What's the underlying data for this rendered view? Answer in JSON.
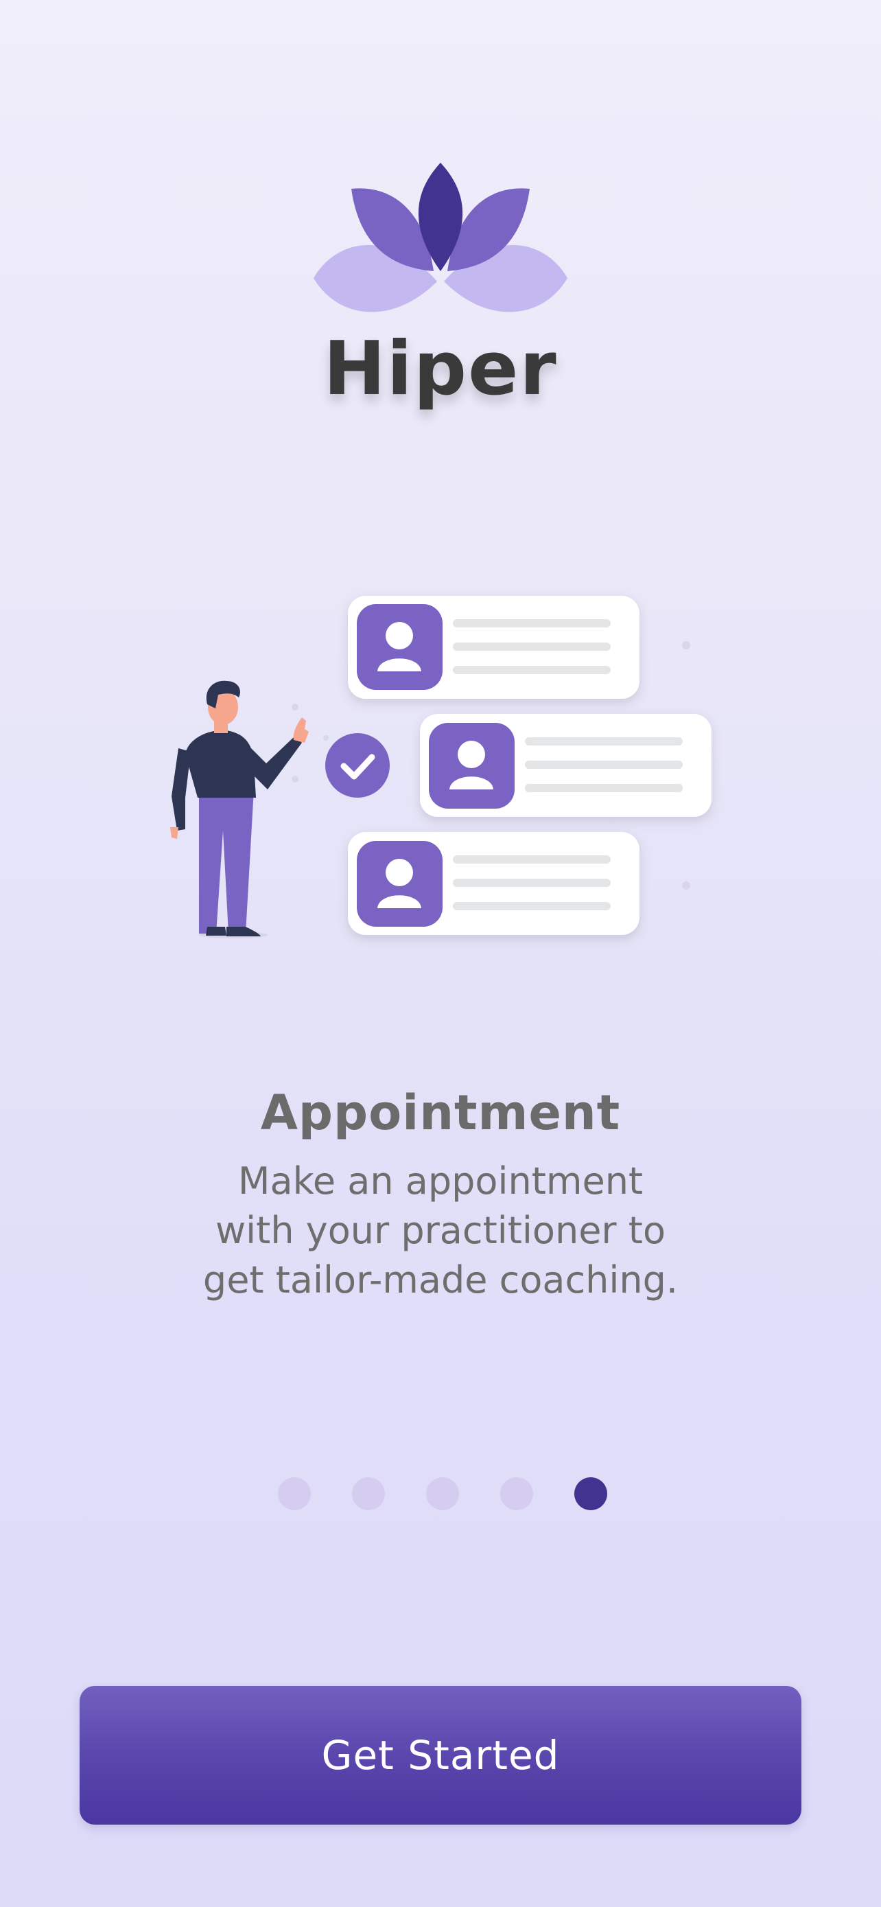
{
  "app": {
    "name": "Hiper"
  },
  "colors": {
    "accent": "#7a64c3",
    "accent_dark": "#433391",
    "petal_light": "#c4b8f0",
    "text_gray": "#6b6b6b"
  },
  "onboarding": {
    "title": "Appointment",
    "description": "Make an appointment with your practitioner to get tailor-made coaching.",
    "illustration": {
      "icon_names": [
        "person-icon",
        "check-icon",
        "profile-card-icon"
      ]
    },
    "pagination": {
      "total": 5,
      "active_index": 4
    }
  },
  "cta": {
    "label": "Get Started"
  }
}
